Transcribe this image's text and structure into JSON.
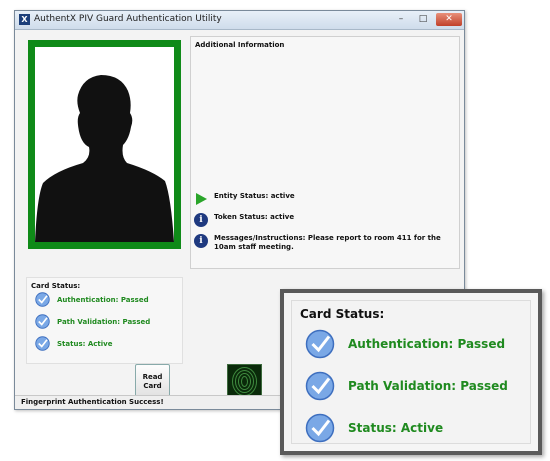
{
  "window": {
    "title": "AuthentX PIV Guard Authentication Utility",
    "icon_letter": "X",
    "min_glyph": "–",
    "max_glyph": "□",
    "close_glyph": "✕"
  },
  "info": {
    "title": "Additional Information",
    "entity_status": "Entity Status: active",
    "token_status": "Token Status: active",
    "messages": "Messages/Instructions: Please report to room 411 for the 10am staff meeting.",
    "info_glyph": "i"
  },
  "card_status": {
    "title": "Card Status:",
    "items": [
      {
        "label": "Authentication: Passed"
      },
      {
        "label": "Path Validation: Passed"
      },
      {
        "label": "Status: Active"
      }
    ]
  },
  "read_button": {
    "label": "Read Card"
  },
  "status_bar": {
    "text": "Fingerprint Authentication Success!"
  },
  "colors": {
    "photo_border": "#0f8a18",
    "status_green": "#208a20",
    "info_blue": "#1f3a80",
    "callout_green": "#6f9f86",
    "titlebar": "#cfdceb"
  },
  "icons": {
    "entity": "play-arrow-icon",
    "token": "info-icon",
    "messages": "info-icon",
    "check": "check-circle-icon",
    "fingerprint": "fingerprint-icon"
  }
}
